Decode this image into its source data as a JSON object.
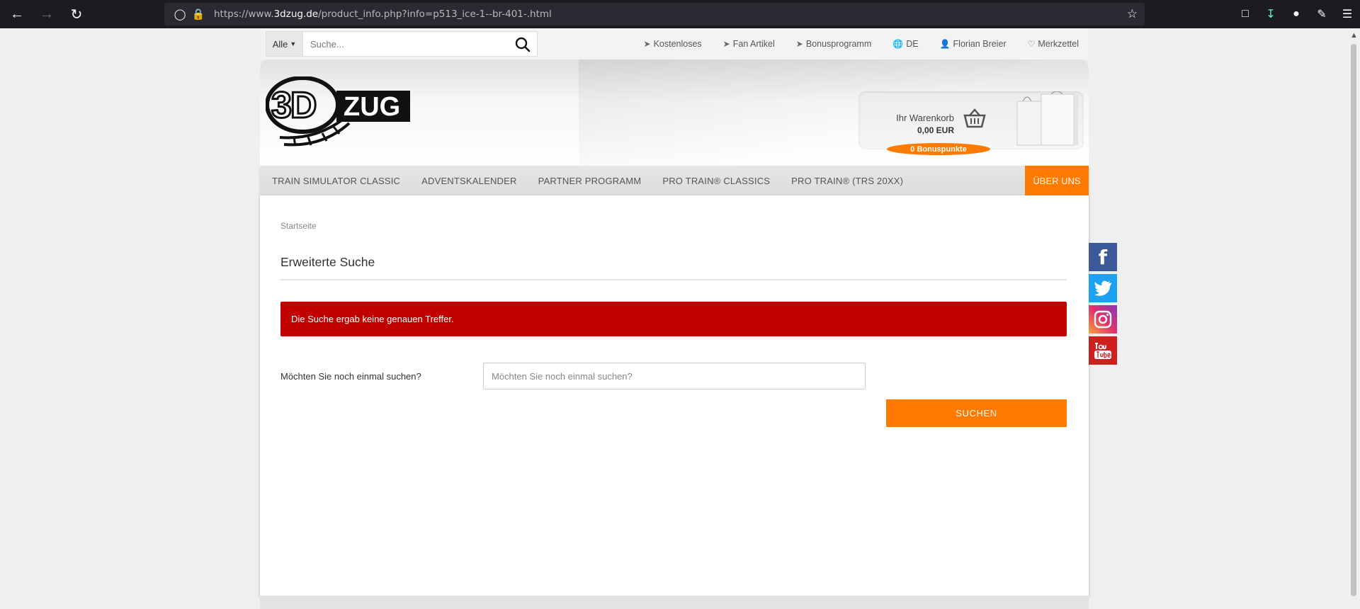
{
  "browser": {
    "url_prefix": "https://www.",
    "url_domain": "3dzug.de",
    "url_rest": "/product_info.php?info=p513_ice-1--br-401-.html"
  },
  "topbar": {
    "search_category": "Alle",
    "search_placeholder": "Suche...",
    "links": [
      {
        "label": "Kostenloses",
        "icon": "arrow-circle-icon"
      },
      {
        "label": "Fan Artikel",
        "icon": "arrow-circle-icon"
      },
      {
        "label": "Bonusprogramm",
        "icon": "arrow-circle-icon"
      },
      {
        "label": "DE",
        "icon": "globe-icon"
      },
      {
        "label": "Florian Breier",
        "icon": "user-icon"
      },
      {
        "label": "Merkzettel",
        "icon": "heart-icon"
      }
    ]
  },
  "header": {
    "cart_title": "Ihr Warenkorb",
    "cart_sum": "0,00 EUR",
    "bonus_points": "0 Bonuspunkte"
  },
  "nav": {
    "items": [
      "TRAIN SIMULATOR CLASSIC",
      "ADVENTSKALENDER",
      "PARTNER PROGRAMM",
      "PRO TRAIN® CLASSICS",
      "PRO TRAIN® (TRS 20XX)"
    ],
    "about": "ÜBER UNS"
  },
  "content": {
    "breadcrumb": "Startseite",
    "title": "Erweiterte Suche",
    "alert": "Die Suche ergab keine genauen Treffer.",
    "form_label": "Möchten Sie noch einmal suchen?",
    "form_placeholder": "Möchten Sie noch einmal suchen?",
    "submit": "SUCHEN"
  },
  "colors": {
    "accent": "#ff7a00",
    "alert": "#c20000"
  }
}
